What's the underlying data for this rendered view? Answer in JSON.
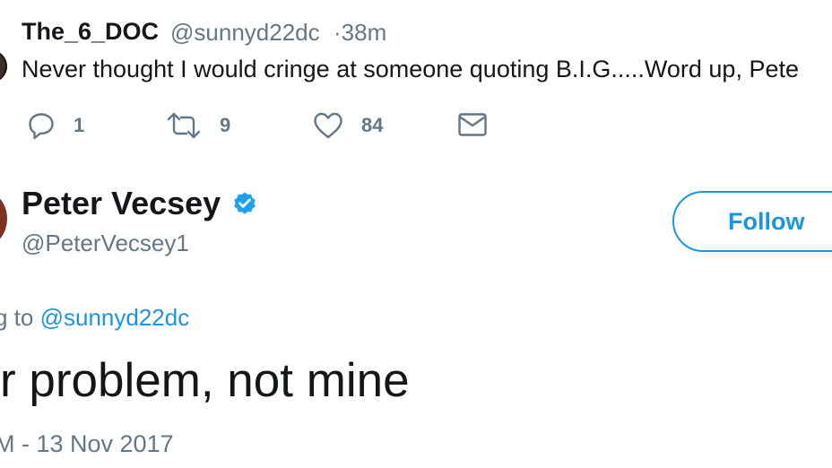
{
  "top_tweet": {
    "display_name": "The_6_DOC",
    "handle": "@sunnyd22dc",
    "time": "·38m",
    "text": "Never thought I would cringe at someone quoting B.I.G.....Word up, Pete",
    "reply_count": "1",
    "retweet_count": "9",
    "like_count": "84",
    "icons": [
      "reply-icon",
      "retweet-icon",
      "like-icon",
      "direct-message-icon"
    ]
  },
  "main_tweet": {
    "display_name": "Peter Vecsey",
    "handle": "@PeterVecsey1",
    "verified": true,
    "follow_label": "Follow",
    "replying_prefix": "g to ",
    "replying_handle": "@sunnyd22dc",
    "text": "r problem, not mine",
    "date": "M - 13 Nov 2017"
  },
  "colors": {
    "accent": "#1b95e0",
    "text": "#14171a",
    "muted": "#657786"
  }
}
